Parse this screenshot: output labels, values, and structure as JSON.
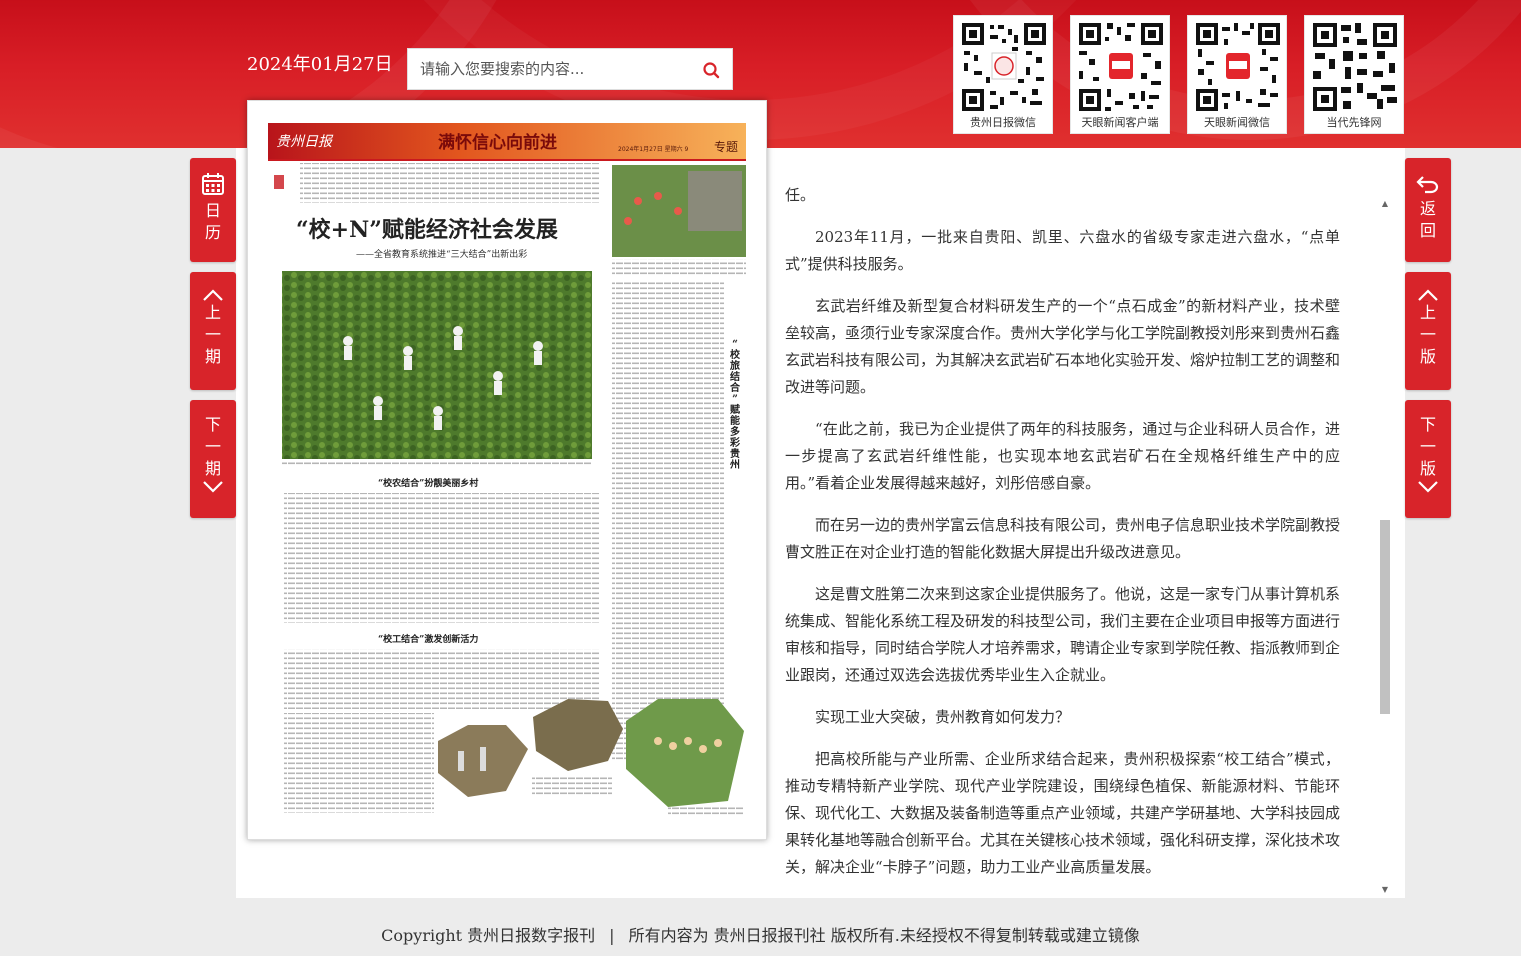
{
  "header": {
    "date": "2024年01月27日",
    "search_placeholder": "请输入您要搜索的内容...",
    "qr_codes": [
      {
        "label": "贵州日报微信"
      },
      {
        "label": "天眼新闻客户端"
      },
      {
        "label": "天眼新闻微信"
      },
      {
        "label": "当代先锋网"
      }
    ]
  },
  "left_nav": {
    "calendar": "日历",
    "prev_issue": "上一期",
    "next_issue": "下一期"
  },
  "right_nav": {
    "back": "返回",
    "prev_page": "上一版",
    "next_page": "下一版"
  },
  "newspaper": {
    "masthead": "贵州日报",
    "section_banner": "满怀信心向前进",
    "page_info": "2024年1月27日 星期六 9",
    "section": "专题",
    "headline": "“校+N”赋能经济社会发展",
    "subheadline": "——全省教育系统推进“三大结合”出新出彩",
    "subhead_1": "“校农结合”扮靓美丽乡村",
    "subhead_2": "“校工结合”激发创新活力",
    "side_title": "“校旅结合”赋能多彩贵州"
  },
  "article": {
    "paragraphs": [
      "任。",
      "2023年11月，一批来自贵阳、凯里、六盘水的省级专家走进六盘水，“点单式”提供科技服务。",
      "玄武岩纤维及新型复合材料研发生产的一个“点石成金”的新材料产业，技术壁垒较高，亟须行业专家深度合作。贵州大学化学与化工学院副教授刘彤来到贵州石鑫玄武岩科技有限公司，为其解决玄武岩矿石本地化实验开发、熔炉拉制工艺的调整和改进等问题。",
      "“在此之前，我已为企业提供了两年的科技服务，通过与企业科研人员合作，进一步提高了玄武岩纤维性能，也实现本地玄武岩矿石在全规格纤维生产中的应用。”看着企业发展得越来越好，刘彤倍感自豪。",
      "而在另一边的贵州学富云信息科技有限公司，贵州电子信息职业技术学院副教授曹文胜正在对企业打造的智能化数据大屏提出升级改进意见。",
      "这是曹文胜第二次来到这家企业提供服务了。他说，这是一家专门从事计算机系统集成、智能化系统工程及研发的科技型公司，我们主要在企业项目申报等方面进行审核和指导，同时结合学院人才培养需求，聘请企业专家到学院任教、指派教师到企业跟岗，还通过双选会选拔优秀毕业生入企就业。",
      "实现工业大突破，贵州教育如何发力？",
      "把高校所能与产业所需、企业所求结合起来，贵州积极探索“校工结合”模式，推动专精特新产业学院、现代产业学院建设，围绕绿色植保、新能源材料、节能环保、现代化工、大数据及装备制造等重点产业领域，共建产学研基地、大学科技园成果转化基地等融合创新平台。尤其在关键核心技术领域，强化科研支撑，深化技术攻关，解决企业“卡脖子”问题，助力工业产业高质量发展。"
    ]
  },
  "footer": {
    "copyright": "Copyright 贵州日报数字报刊",
    "separator": "|",
    "rights": "所有内容为 贵州日报报刊社 版权所有.未经授权不得复制转载或建立镜像"
  },
  "colors": {
    "brand_red": "#d8242a",
    "header_red": "#c70f1a"
  }
}
